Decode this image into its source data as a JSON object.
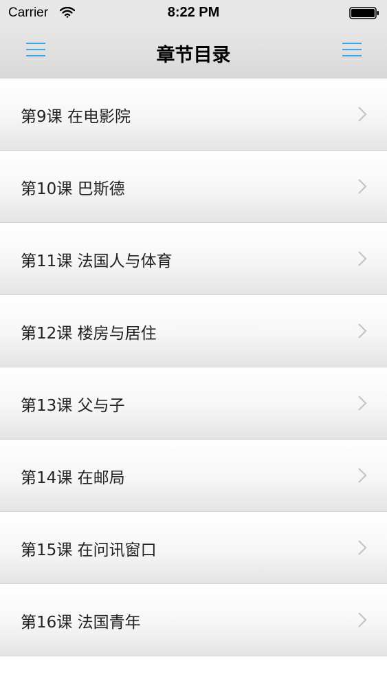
{
  "status_bar": {
    "carrier": "Carrier",
    "time": "8:22 PM"
  },
  "nav": {
    "title": "章节目录",
    "left_icon": "menu-icon",
    "right_icon": "menu-icon",
    "accent_color": "#3aa6e8"
  },
  "chapters": [
    {
      "label": "第9课 在电影院"
    },
    {
      "label": "第10课 巴斯德"
    },
    {
      "label": "第11课 法国人与体育"
    },
    {
      "label": "第12课 楼房与居住"
    },
    {
      "label": "第13课 父与子"
    },
    {
      "label": "第14课 在邮局"
    },
    {
      "label": "第15课 在问讯窗口"
    },
    {
      "label": "第16课 法国青年"
    }
  ]
}
